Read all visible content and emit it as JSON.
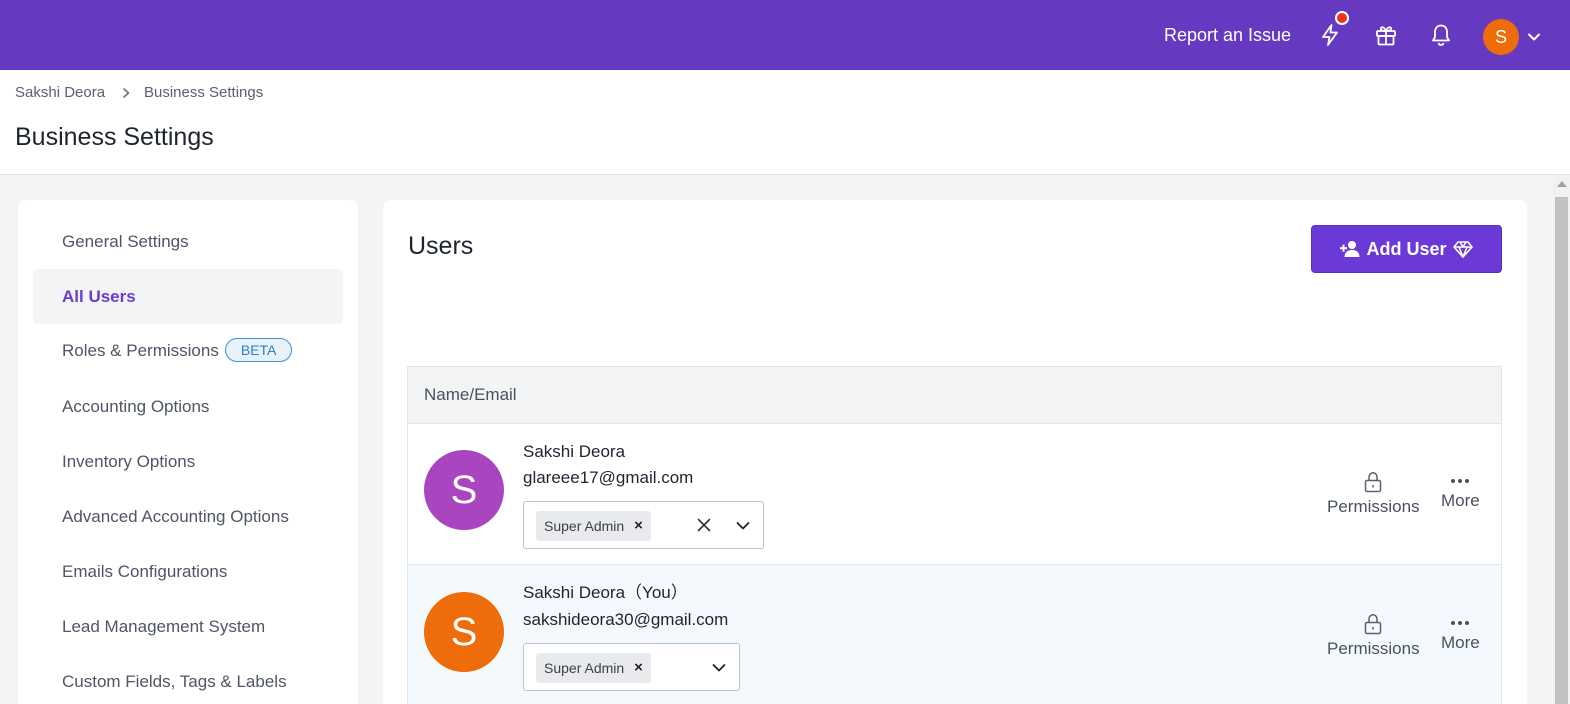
{
  "topbar": {
    "report_label": "Report an Issue",
    "icons": [
      "lightning-icon",
      "gift-icon",
      "bell-icon"
    ],
    "avatar_initial": "S",
    "accent_color": "#6639c1",
    "avatar_color": "#ee6c09"
  },
  "breadcrumb": {
    "items": [
      "Sakshi Deora",
      "Business Settings"
    ]
  },
  "page_title": "Business Settings",
  "sidebar": {
    "items": [
      {
        "label": "General Settings"
      },
      {
        "label": "All Users",
        "active": true
      },
      {
        "label": "Roles & Permissions",
        "badge": "BETA"
      },
      {
        "label": "Accounting Options"
      },
      {
        "label": "Inventory Options"
      },
      {
        "label": "Advanced Accounting Options"
      },
      {
        "label": "Emails Configurations"
      },
      {
        "label": "Lead Management System"
      },
      {
        "label": "Custom Fields, Tags & Labels"
      }
    ]
  },
  "main": {
    "title": "Users",
    "add_user_label": "Add User",
    "table": {
      "header": "Name/Email",
      "rows": [
        {
          "avatar_initial": "S",
          "avatar_color": "#a946bf",
          "name": "Sakshi Deora",
          "email": "glareee17@gmail.com",
          "role": "Super Admin",
          "permissions_label": "Permissions",
          "more_label": "More"
        },
        {
          "avatar_initial": "S",
          "avatar_color": "#ee6c09",
          "name": "Sakshi Deora（You）",
          "email": "sakshideora30@gmail.com",
          "role": "Super Admin",
          "permissions_label": "Permissions",
          "more_label": "More"
        }
      ]
    }
  }
}
